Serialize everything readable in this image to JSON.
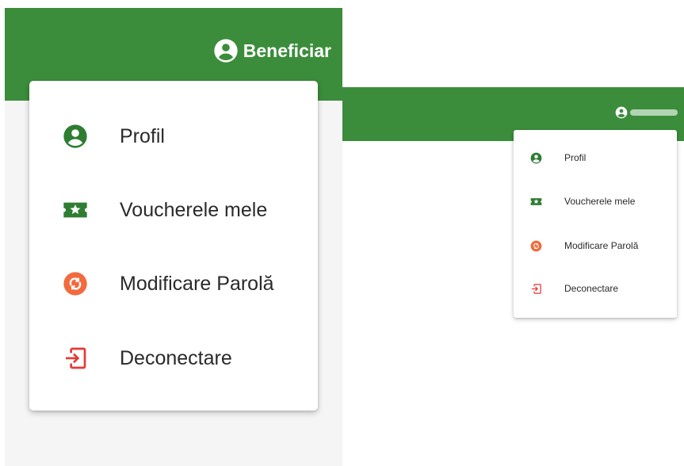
{
  "colors": {
    "appbar": "#3b8d3b",
    "green_icon": "#2e7d32",
    "orange_icon": "#f26a3d",
    "red_icon": "#e53935"
  },
  "large": {
    "user_label": "Beneficiar",
    "menu": {
      "items": [
        {
          "label": "Profil",
          "icon": "account-circle-icon"
        },
        {
          "label": "Voucherele mele",
          "icon": "ticket-star-icon"
        },
        {
          "label": "Modificare Parolă",
          "icon": "password-sync-icon"
        },
        {
          "label": "Deconectare",
          "icon": "logout-icon"
        }
      ]
    }
  },
  "small": {
    "menu": {
      "items": [
        {
          "label": "Profil",
          "icon": "account-circle-icon"
        },
        {
          "label": "Voucherele mele",
          "icon": "ticket-star-icon"
        },
        {
          "label": "Modificare Parolă",
          "icon": "password-sync-icon"
        },
        {
          "label": "Deconectare",
          "icon": "logout-icon"
        }
      ]
    }
  }
}
